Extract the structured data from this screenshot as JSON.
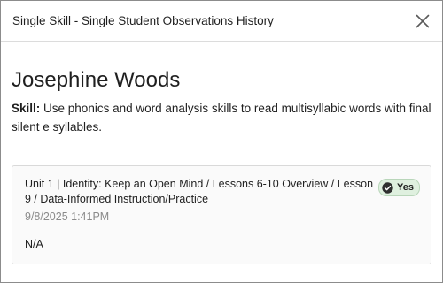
{
  "dialog": {
    "title": "Single Skill - Single Student Observations History"
  },
  "student": {
    "name": "Josephine Woods"
  },
  "skill": {
    "label": "Skill:",
    "text": "Use phonics and word analysis skills to read multisyllabic words with final silent e syllables."
  },
  "observations": [
    {
      "path": "Unit 1 | Identity: Keep an Open Mind / Lessons 6-10 Overview / Lesson 9 / Data-Informed Instruction/Practice",
      "badge": "Yes",
      "badge_color": "#dff0df",
      "timestamp": "9/8/2025 1:41PM",
      "value": "N/A"
    }
  ],
  "icons": {
    "close": "close-icon",
    "check": "check-circle-icon"
  }
}
